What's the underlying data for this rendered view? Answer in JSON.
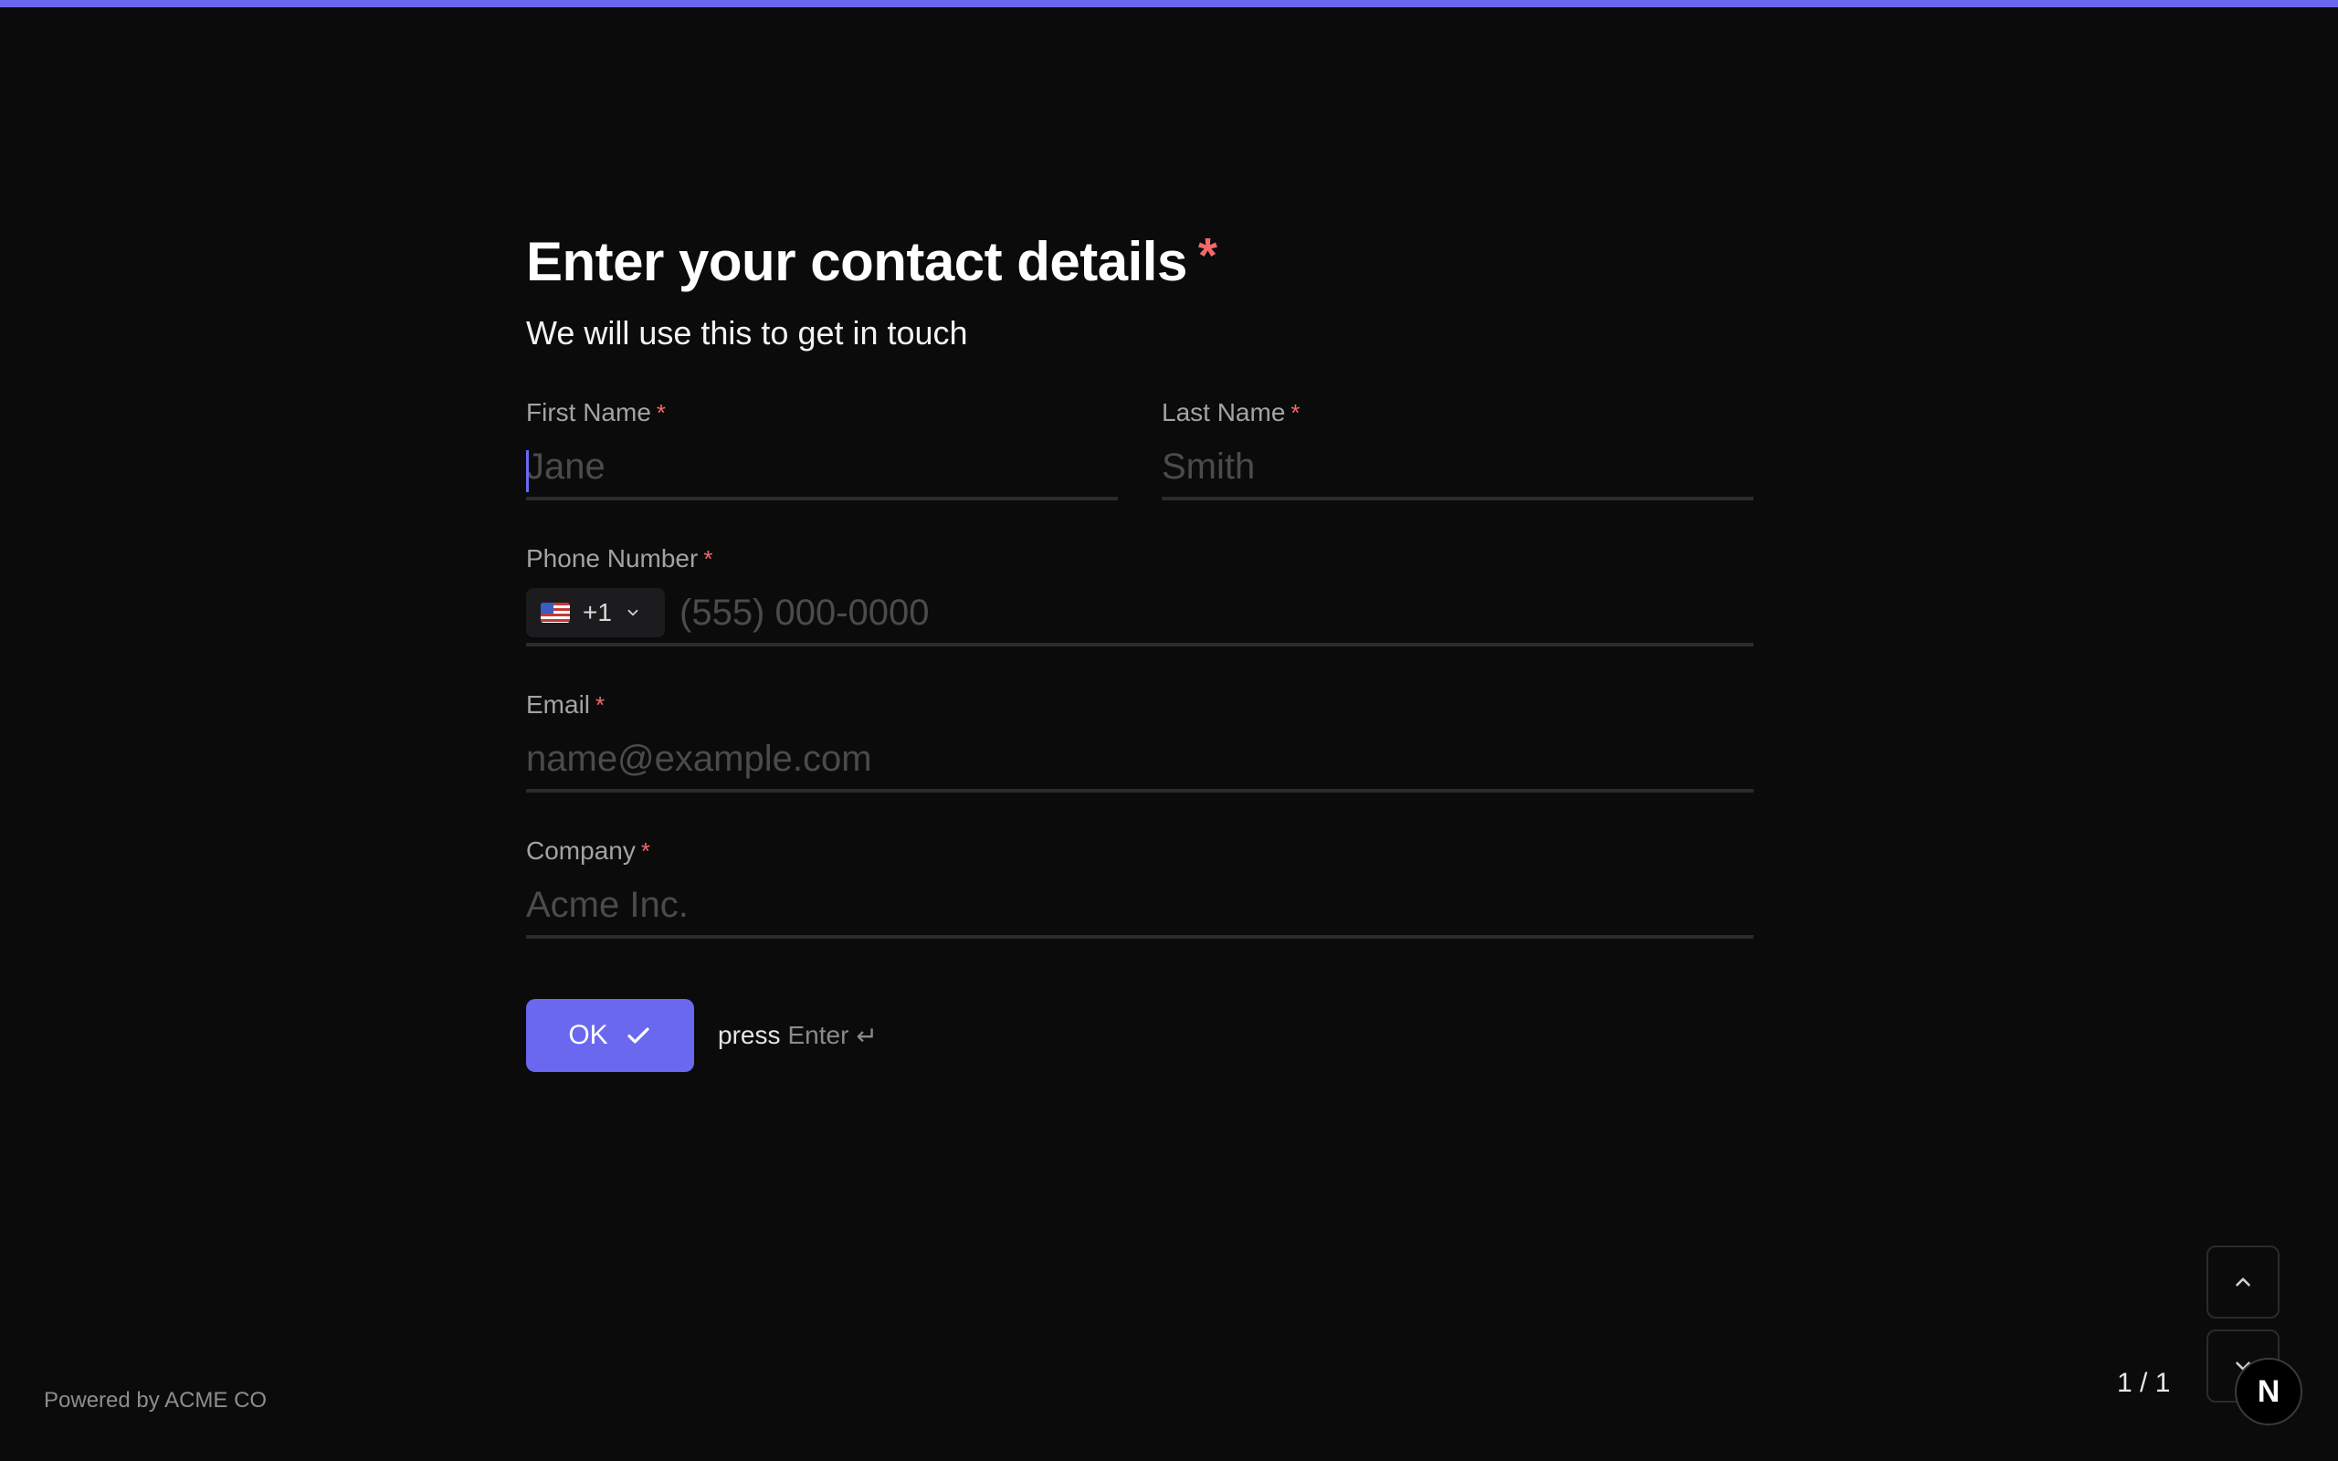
{
  "progress": {
    "fraction": 1.0,
    "color": "#6b68f0"
  },
  "question": {
    "title": "Enter your contact details",
    "required_mark": "*",
    "subtitle": "We will use this to get in touch"
  },
  "fields": {
    "first_name": {
      "label": "First Name",
      "placeholder": "Jane",
      "value": ""
    },
    "last_name": {
      "label": "Last Name",
      "placeholder": "Smith",
      "value": ""
    },
    "phone": {
      "label": "Phone Number",
      "country_flag": "us-flag-icon",
      "dial_code": "+1",
      "placeholder": "(555) 000-0000",
      "value": ""
    },
    "email": {
      "label": "Email",
      "placeholder": "name@example.com",
      "value": ""
    },
    "company": {
      "label": "Company",
      "placeholder": "Acme Inc.",
      "value": ""
    }
  },
  "actions": {
    "ok_label": "OK",
    "hint_prefix": "press",
    "hint_key": "Enter",
    "hint_icon": "↵"
  },
  "footer": {
    "brand": "Powered by ACME CO",
    "counter": "1 / 1",
    "avatar_letter": "N"
  },
  "colors": {
    "background": "#0b0b0c",
    "accent": "#6b68f0",
    "required": "#f06a6a"
  }
}
